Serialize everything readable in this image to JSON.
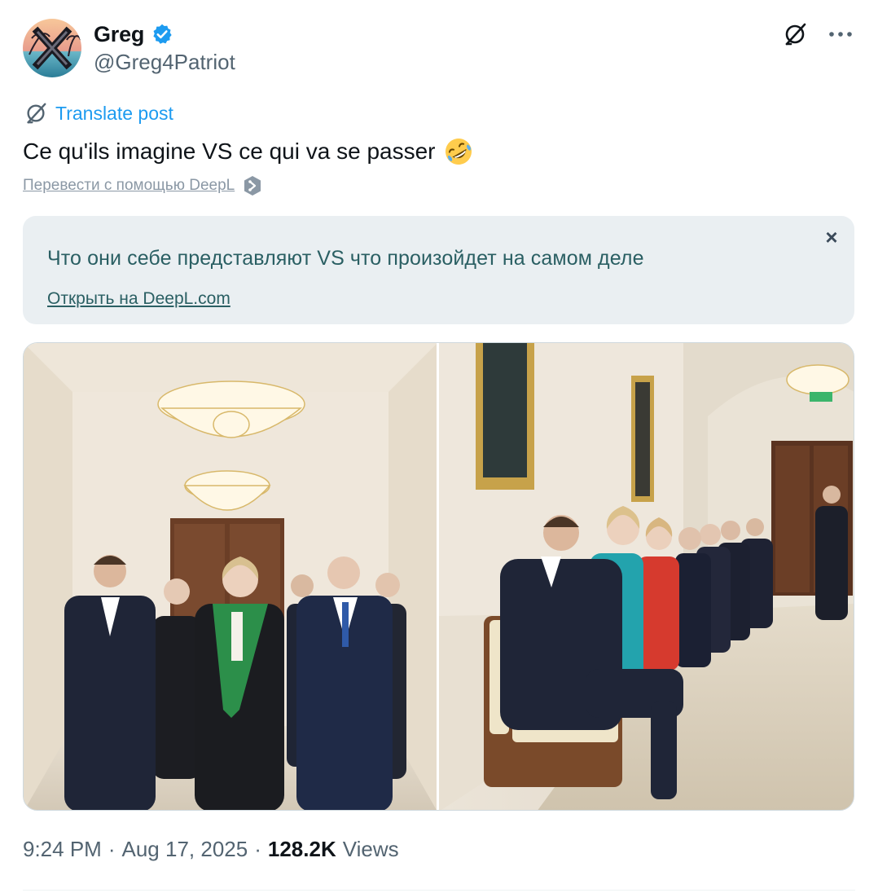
{
  "author": {
    "display_name": "Greg",
    "handle": "@Greg4Patriot",
    "verified": true,
    "avatar_icon": "avatar-x-logo-palm-sunset"
  },
  "header_actions": {
    "grok_icon": "grok-icon",
    "more_icon": "more-icon"
  },
  "translate": {
    "label": "Translate post",
    "icon": "translate-icon"
  },
  "post": {
    "text": "Ce qu'ils imagine VS ce qui va se passer",
    "emoji": "rolling-on-floor-laughing-emoji"
  },
  "deepl": {
    "link_label": "Перевести с помощью DeepL",
    "translation": "Что они себе представляют VS что произойдет на самом деле",
    "open_label": "Открыть на DeepL.com",
    "close_label": "×"
  },
  "media": {
    "images": [
      "image-leaders-walking-hallway",
      "image-leaders-seated-waiting"
    ]
  },
  "meta": {
    "time": "9:24 PM",
    "separator": "·",
    "date": "Aug 17, 2025",
    "views_count": "128.2K",
    "views_label": "Views"
  },
  "colors": {
    "accent": "#1d9bf0",
    "secondary_text": "#536471",
    "deepl_bg": "#eaeff2",
    "deepl_text": "#2a5f63"
  }
}
